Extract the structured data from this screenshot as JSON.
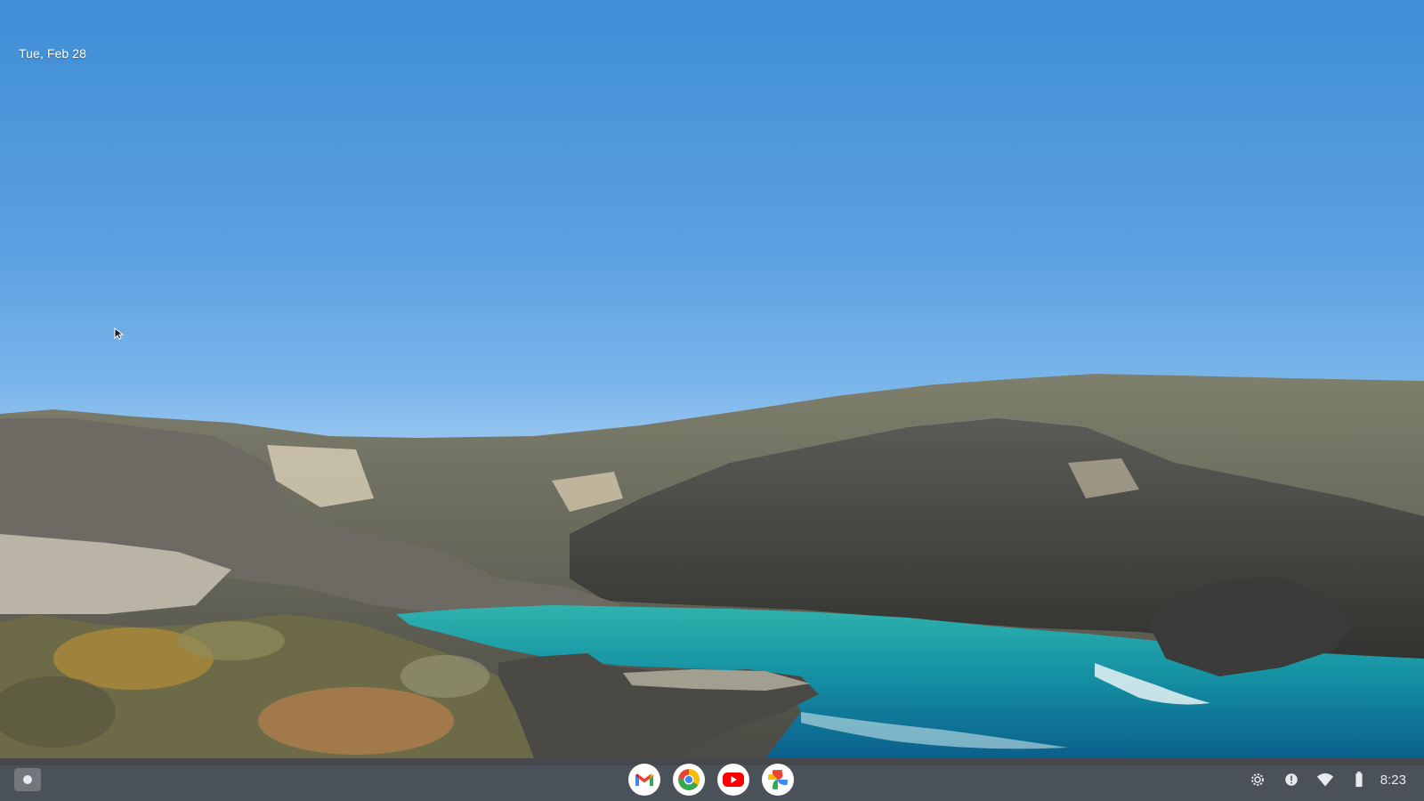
{
  "desktop": {
    "date": "Tue, Feb 28",
    "wallpaper": "coastal-cove-landscape"
  },
  "shelf": {
    "launcher_icon": "launcher-icon",
    "apps": [
      {
        "name": "Gmail",
        "icon": "gmail-icon"
      },
      {
        "name": "Chrome",
        "icon": "chrome-icon"
      },
      {
        "name": "YouTube",
        "icon": "youtube-icon"
      },
      {
        "name": "Google Photos",
        "icon": "photos-icon"
      }
    ],
    "status": {
      "icons": [
        "settings-icon",
        "notification-icon",
        "wifi-icon",
        "battery-icon"
      ],
      "time": "8:23"
    }
  },
  "colors": {
    "sky_top": "#3f8ed6",
    "water": "#1fa5a8",
    "shelf_bg": "#46484c"
  }
}
